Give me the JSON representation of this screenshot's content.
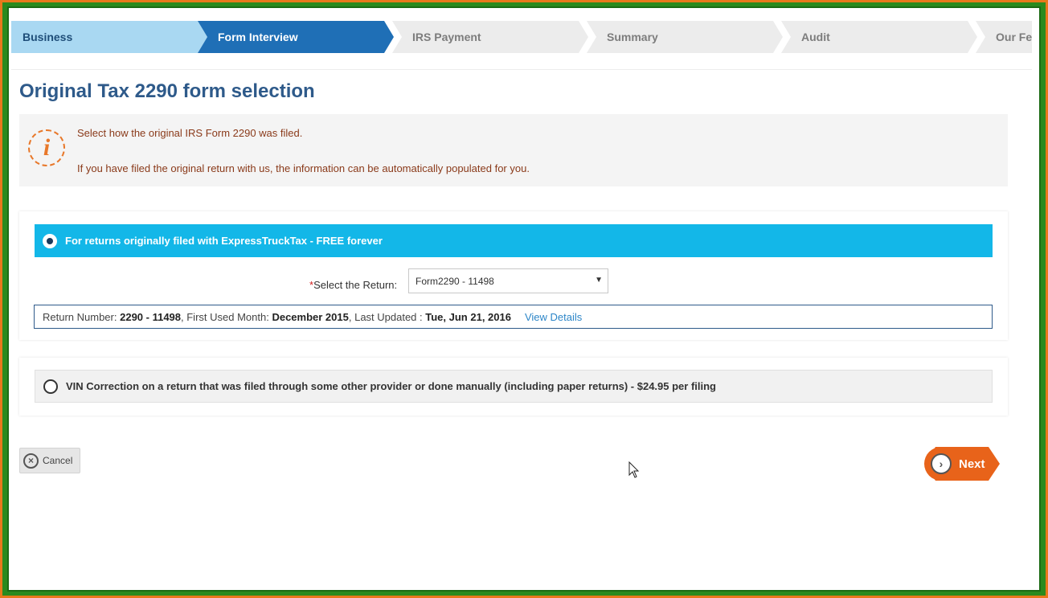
{
  "steps": [
    {
      "label": "Business",
      "state": "done"
    },
    {
      "label": "Form Interview",
      "state": "active"
    },
    {
      "label": "IRS Payment",
      "state": "todo"
    },
    {
      "label": "Summary",
      "state": "todo"
    },
    {
      "label": "Audit",
      "state": "todo"
    },
    {
      "label": "Our Fee",
      "state": "todo"
    }
  ],
  "page": {
    "title": "Original Tax 2290 form selection"
  },
  "info": {
    "icon": "info-icon",
    "glyph": "i",
    "line1": "Select how the original IRS Form 2290 was filed.",
    "line2": "If you have filed the original return with us, the information can be automatically populated for you."
  },
  "option1": {
    "label": "For returns originally filed with ExpressTruckTax - FREE forever",
    "checked": true,
    "select_required_mark": "*",
    "select_label": "Select the Return:",
    "select_value": "Form2290 - 11498",
    "return_number_label": "Return Number:",
    "return_number": "2290 - 11498",
    "first_used_label": ", First Used Month:",
    "first_used": "December 2015",
    "last_updated_label": ", Last Updated :",
    "last_updated": "Tue, Jun 21, 2016",
    "view_details": "View Details"
  },
  "option2": {
    "label": "VIN Correction on a return that was filed through some other provider or done manually (including paper returns) - $24.95 per filing",
    "checked": false
  },
  "buttons": {
    "cancel": "Cancel",
    "next": "Next"
  },
  "colors": {
    "accent_blue": "#1f6fb6",
    "option_blue": "#13b7e8",
    "orange": "#e8631a",
    "title_blue": "#2e5a8a"
  }
}
